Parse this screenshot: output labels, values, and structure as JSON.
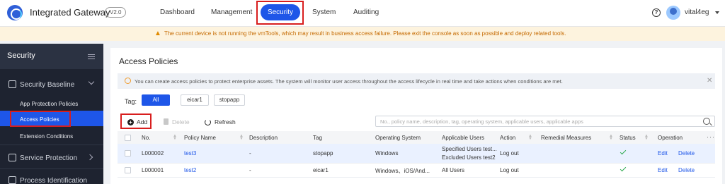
{
  "header": {
    "app_title": "Integrated Gateway",
    "version": "V2.0",
    "tabs": [
      "Dashboard",
      "Management",
      "Security",
      "System",
      "Auditing"
    ],
    "active_tab": "Security",
    "username": "vital4eg"
  },
  "warning": {
    "text": "The current device is not running the vmTools, which may result in business access failure. Please exit the console as soon as possible and deploy related tools."
  },
  "sidebar": {
    "title": "Security",
    "groups": [
      {
        "label": "Security Baseline",
        "icon": "shield-icon"
      },
      {
        "label": "Service Protection",
        "icon": "service-icon"
      },
      {
        "label": "Process Identification",
        "icon": "process-icon"
      }
    ],
    "sub_items": [
      "App Protection Policies",
      "Access Policies",
      "Extension Conditions"
    ],
    "active_item": "Access Policies"
  },
  "main": {
    "title": "Access Policies",
    "info": "You can create access policies to protect enterprise assets. The system will monitor user access throughout the access lifecycle in real time and take actions when conditions are met.",
    "tag_label": "Tag:",
    "tags": [
      "All",
      "eicar1",
      "stopapp"
    ],
    "toolbar": {
      "add": "Add",
      "delete": "Delete",
      "refresh": "Refresh"
    },
    "search_placeholder": "No., policy name, description, tag, operating system, applicable users, applicable apps",
    "table": {
      "headers": [
        "No.",
        "Policy Name",
        "Description",
        "Tag",
        "Operating System",
        "Applicable Users",
        "Action",
        "Remedial Measures",
        "Status",
        "Operation"
      ],
      "rows": [
        {
          "no": "L000002",
          "name": "test3",
          "description": "-",
          "tag": "stopapp",
          "os": "Windows",
          "users_line1": "Specified Users test...",
          "users_line2": "Excluded Users test2",
          "action": "Log out",
          "remedial": "",
          "status": "enabled",
          "edit": "Edit",
          "delete": "Delete"
        },
        {
          "no": "L000001",
          "name": "test2",
          "description": "-",
          "tag": "eicar1",
          "os": "Windows、iOS/And...",
          "users_line1": "All Users",
          "users_line2": "",
          "action": "Log out",
          "remedial": "",
          "status": "enabled",
          "edit": "Edit",
          "delete": "Delete"
        }
      ]
    }
  },
  "colors": {
    "accent": "#1e56e8",
    "highlight": "#d81e1e",
    "sidebar_bg": "#1e2330",
    "warning_bg": "#fdf3de",
    "status_ok": "#2da94f"
  }
}
